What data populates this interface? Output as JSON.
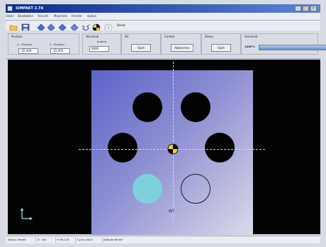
{
  "app": {
    "title": "SIMPAKT 2.7A"
  },
  "menu": {
    "items": [
      "Datei",
      "Bearbeiten",
      "Ansicht",
      "Maschine",
      "Fenster",
      "Option"
    ]
  },
  "toolbar": {
    "buttons": [
      "open-folder-icon",
      "save-icon",
      "diamond-left-icon",
      "diamond-right-icon",
      "diamond-up-icon",
      "diamond-down-icon",
      "zigzag-icon",
      "target-icon",
      "compass-icon"
    ],
    "status_label": "Bereit"
  },
  "controls": {
    "position_title": "Position",
    "x_label": "X - Position",
    "x_value": "-25,000",
    "y_label": "Y - Position",
    "y_value": "-25,955",
    "feed_title": "Vorschub",
    "feed_field_label": "ändern",
    "feed_value": "6000",
    "nc_title": "NC",
    "nc_button": "Start",
    "control_title": "Control",
    "control_button": "Abbrechen",
    "demo_title": "Demo",
    "demo_button": "Start",
    "vorschub_title": "Vorschub",
    "zoom_label": "100P%",
    "zoom_value_percent": 100
  },
  "canvas": {
    "workpiece_label": "W7",
    "crosshair": true,
    "holes": {
      "top_left": "filled",
      "top_right": "filled",
      "middle_left": "filled",
      "middle_right": "filled",
      "bottom_left": "selected",
      "bottom_right": "outline"
    }
  },
  "statusbar": {
    "text_1": "Status: Bereit",
    "text_2": "X: 160",
    "text_3": "Y: 96,125",
    "text_4": "Cyclic Aktiv",
    "text_5": "Ablaufe Bereit"
  }
}
